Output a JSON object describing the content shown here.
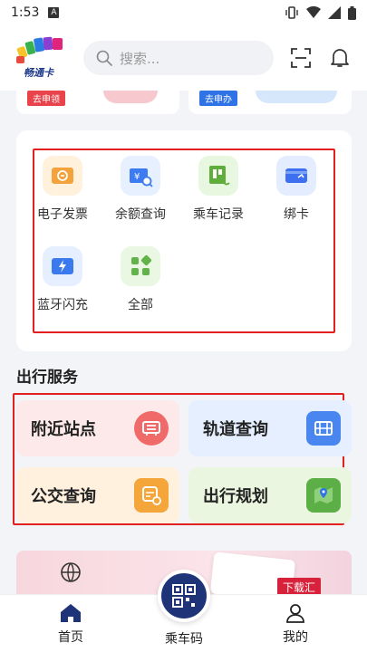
{
  "status_bar": {
    "time": "1:53",
    "notification_letter": "A"
  },
  "header": {
    "logo_text": "畅通卡",
    "search_placeholder": "搜索..."
  },
  "banners": [
    {
      "tag": "去申领"
    },
    {
      "tag": "去申办"
    }
  ],
  "functions": [
    {
      "label": "电子发票",
      "icon": "invoice-icon",
      "bg": "#fff1dc",
      "color": "#f3a23c"
    },
    {
      "label": "余额查询",
      "icon": "balance-query-icon",
      "bg": "#e6f0ff",
      "color": "#3d7bf2"
    },
    {
      "label": "乘车记录",
      "icon": "ride-record-icon",
      "bg": "#e8f7df",
      "color": "#5fae3c"
    },
    {
      "label": "绑卡",
      "icon": "bind-card-icon",
      "bg": "#e4ecff",
      "color": "#3e6ff0"
    },
    {
      "label": "蓝牙闪充",
      "icon": "bluetooth-charge-icon",
      "bg": "#e6efff",
      "color": "#3b79ef"
    },
    {
      "label": "全部",
      "icon": "all-apps-icon",
      "bg": "#e9f7e3",
      "color": "#62b24a"
    }
  ],
  "section_title": "出行服务",
  "services": [
    {
      "label": "附近站点",
      "icon": "nearby-station-icon",
      "bg": "#fde9e9",
      "icon_bg": "#f06a6a"
    },
    {
      "label": "轨道查询",
      "icon": "rail-query-icon",
      "bg": "#e5efff",
      "icon_bg": "#4a86f0"
    },
    {
      "label": "公交查询",
      "icon": "bus-query-icon",
      "bg": "#fff1de",
      "icon_bg": "#f4a63a"
    },
    {
      "label": "出行规划",
      "icon": "trip-plan-icon",
      "bg": "#eaf6df",
      "icon_bg": "#5cae46"
    }
  ],
  "promo": {
    "badge": "下载汇"
  },
  "nav": {
    "home": "首页",
    "ride_code": "乘车码",
    "mine": "我的"
  },
  "colors": {
    "accent": "#1f3478",
    "highlight_box": "#e32020"
  }
}
